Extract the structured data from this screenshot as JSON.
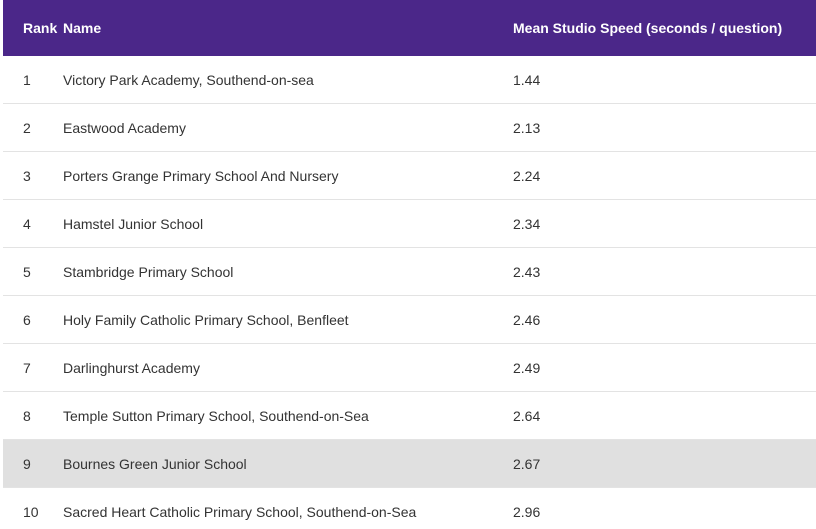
{
  "table": {
    "headers": {
      "rank": "Rank",
      "name": "Name",
      "speed": "Mean Studio Speed (seconds / question)"
    },
    "header_color": "#4b2789",
    "highlight_color": "#e0e0e0",
    "rows": [
      {
        "rank": "1",
        "name": "Victory Park Academy, Southend-on-sea",
        "speed": "1.44"
      },
      {
        "rank": "2",
        "name": "Eastwood Academy",
        "speed": "2.13"
      },
      {
        "rank": "3",
        "name": "Porters Grange Primary School And Nursery",
        "speed": "2.24"
      },
      {
        "rank": "4",
        "name": "Hamstel Junior School",
        "speed": "2.34"
      },
      {
        "rank": "5",
        "name": "Stambridge Primary School",
        "speed": "2.43"
      },
      {
        "rank": "6",
        "name": "Holy Family Catholic Primary School, Benfleet",
        "speed": "2.46"
      },
      {
        "rank": "7",
        "name": "Darlinghurst Academy",
        "speed": "2.49"
      },
      {
        "rank": "8",
        "name": "Temple Sutton Primary School, Southend-on-Sea",
        "speed": "2.64"
      },
      {
        "rank": "9",
        "name": "Bournes Green Junior School",
        "speed": "2.67",
        "highlighted": true
      },
      {
        "rank": "10",
        "name": "Sacred Heart Catholic Primary School, Southend-on-Sea",
        "speed": "2.96"
      }
    ]
  }
}
